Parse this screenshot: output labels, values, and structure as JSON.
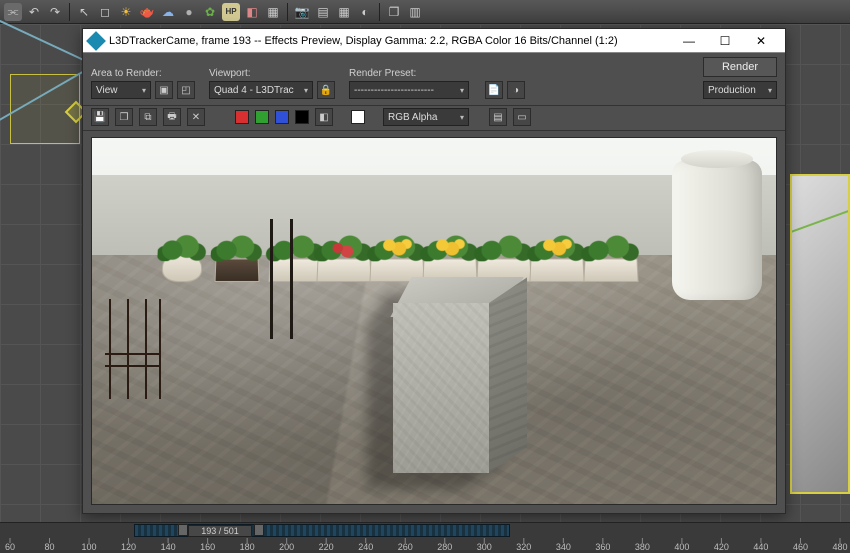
{
  "main_toolbar": {
    "icons": [
      "link",
      "undo",
      "redo",
      "cursor",
      "move",
      "rotate",
      "scale",
      "sun",
      "teapot",
      "cloud",
      "sphere",
      "leaf",
      "hp",
      "paint",
      "camera",
      "grid",
      "wrench",
      "layers",
      "panel"
    ]
  },
  "render_window": {
    "title": "L3DTrackerCame, frame 193 -- Effects Preview, Display Gamma: 2.2, RGBA Color 16 Bits/Channel (1:2)",
    "area_to_render": {
      "label": "Area to Render:",
      "value": "View"
    },
    "viewport": {
      "label": "Viewport:",
      "value": "Quad 4 - L3DTrac"
    },
    "render_preset": {
      "label": "Render Preset:",
      "value": "------------------------"
    },
    "render_button": "Render",
    "production_dropdown": "Production",
    "channel_dropdown": "RGB Alpha",
    "swatches": {
      "red": "#d83030",
      "green": "#30a030",
      "blue": "#3050d8",
      "alpha": "#000000",
      "white": "#ffffff"
    }
  },
  "timeline": {
    "current_frame": 193,
    "total_frames": 501,
    "slider_label": "193 / 501",
    "tick_start": 60,
    "tick_end": 480,
    "tick_step": 20
  }
}
